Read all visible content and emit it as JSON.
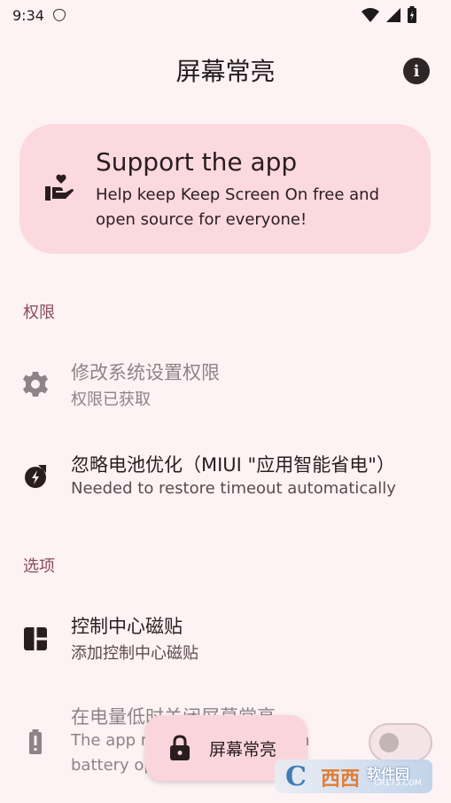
{
  "status_bar": {
    "time": "9:34"
  },
  "app_bar": {
    "title": "屏幕常亮"
  },
  "support_card": {
    "title": "Support the app",
    "description": "Help keep Keep Screen On free and open source for everyone!"
  },
  "sections": {
    "permissions_header": "权限",
    "options_header": "选项"
  },
  "settings": {
    "modify_system": {
      "title": "修改系统设置权限",
      "subtitle": "权限已获取",
      "enabled": false
    },
    "battery_optimization": {
      "title": "忽略电池优化（MIUI \"应用智能省电\"）",
      "subtitle": "Needed to restore timeout automatically"
    },
    "control_center_tile": {
      "title": "控制中心磁贴",
      "subtitle": "添加控制中心磁贴"
    },
    "low_battery": {
      "title": "在电量低时关闭屏幕常亮",
      "subtitle_line1": "The app n",
      "subtitle_line1_tail": "n",
      "subtitle_line2": "battery op",
      "toggle_on": false
    }
  },
  "fab": {
    "label": "屏幕常亮"
  },
  "watermark": {
    "letter": "C",
    "text": "西西",
    "text2": "软件园",
    "sub": "CR173.COM"
  },
  "colors": {
    "background": "#fdf2f4",
    "card": "#fbd9de",
    "section_header": "#8a4a5a",
    "disabled_text": "#8e8487"
  },
  "icons": {
    "status": [
      "shield-icon",
      "wifi-icon",
      "cellular-icon",
      "battery-icon"
    ],
    "app_bar": "info-icon",
    "support": "heart-hand-icon",
    "modify_system": "gear-icon",
    "battery_optimization": "battery-saver-icon",
    "control_center_tile": "dashboard-icon",
    "low_battery": "battery-alert-icon",
    "fab": "lock-icon"
  }
}
